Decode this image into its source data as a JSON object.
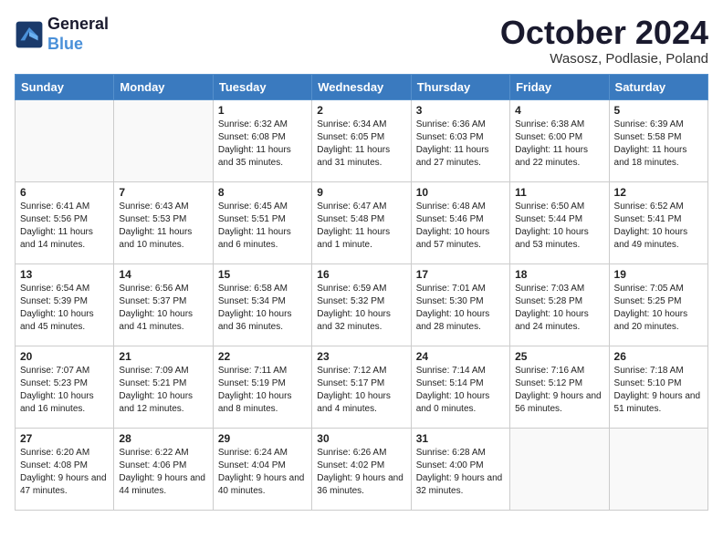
{
  "header": {
    "logo_line1": "General",
    "logo_line2": "Blue",
    "month": "October 2024",
    "location": "Wasosz, Podlasie, Poland"
  },
  "days_of_week": [
    "Sunday",
    "Monday",
    "Tuesday",
    "Wednesday",
    "Thursday",
    "Friday",
    "Saturday"
  ],
  "weeks": [
    [
      {
        "day": "",
        "info": ""
      },
      {
        "day": "",
        "info": ""
      },
      {
        "day": "1",
        "info": "Sunrise: 6:32 AM\nSunset: 6:08 PM\nDaylight: 11 hours and 35 minutes."
      },
      {
        "day": "2",
        "info": "Sunrise: 6:34 AM\nSunset: 6:05 PM\nDaylight: 11 hours and 31 minutes."
      },
      {
        "day": "3",
        "info": "Sunrise: 6:36 AM\nSunset: 6:03 PM\nDaylight: 11 hours and 27 minutes."
      },
      {
        "day": "4",
        "info": "Sunrise: 6:38 AM\nSunset: 6:00 PM\nDaylight: 11 hours and 22 minutes."
      },
      {
        "day": "5",
        "info": "Sunrise: 6:39 AM\nSunset: 5:58 PM\nDaylight: 11 hours and 18 minutes."
      }
    ],
    [
      {
        "day": "6",
        "info": "Sunrise: 6:41 AM\nSunset: 5:56 PM\nDaylight: 11 hours and 14 minutes."
      },
      {
        "day": "7",
        "info": "Sunrise: 6:43 AM\nSunset: 5:53 PM\nDaylight: 11 hours and 10 minutes."
      },
      {
        "day": "8",
        "info": "Sunrise: 6:45 AM\nSunset: 5:51 PM\nDaylight: 11 hours and 6 minutes."
      },
      {
        "day": "9",
        "info": "Sunrise: 6:47 AM\nSunset: 5:48 PM\nDaylight: 11 hours and 1 minute."
      },
      {
        "day": "10",
        "info": "Sunrise: 6:48 AM\nSunset: 5:46 PM\nDaylight: 10 hours and 57 minutes."
      },
      {
        "day": "11",
        "info": "Sunrise: 6:50 AM\nSunset: 5:44 PM\nDaylight: 10 hours and 53 minutes."
      },
      {
        "day": "12",
        "info": "Sunrise: 6:52 AM\nSunset: 5:41 PM\nDaylight: 10 hours and 49 minutes."
      }
    ],
    [
      {
        "day": "13",
        "info": "Sunrise: 6:54 AM\nSunset: 5:39 PM\nDaylight: 10 hours and 45 minutes."
      },
      {
        "day": "14",
        "info": "Sunrise: 6:56 AM\nSunset: 5:37 PM\nDaylight: 10 hours and 41 minutes."
      },
      {
        "day": "15",
        "info": "Sunrise: 6:58 AM\nSunset: 5:34 PM\nDaylight: 10 hours and 36 minutes."
      },
      {
        "day": "16",
        "info": "Sunrise: 6:59 AM\nSunset: 5:32 PM\nDaylight: 10 hours and 32 minutes."
      },
      {
        "day": "17",
        "info": "Sunrise: 7:01 AM\nSunset: 5:30 PM\nDaylight: 10 hours and 28 minutes."
      },
      {
        "day": "18",
        "info": "Sunrise: 7:03 AM\nSunset: 5:28 PM\nDaylight: 10 hours and 24 minutes."
      },
      {
        "day": "19",
        "info": "Sunrise: 7:05 AM\nSunset: 5:25 PM\nDaylight: 10 hours and 20 minutes."
      }
    ],
    [
      {
        "day": "20",
        "info": "Sunrise: 7:07 AM\nSunset: 5:23 PM\nDaylight: 10 hours and 16 minutes."
      },
      {
        "day": "21",
        "info": "Sunrise: 7:09 AM\nSunset: 5:21 PM\nDaylight: 10 hours and 12 minutes."
      },
      {
        "day": "22",
        "info": "Sunrise: 7:11 AM\nSunset: 5:19 PM\nDaylight: 10 hours and 8 minutes."
      },
      {
        "day": "23",
        "info": "Sunrise: 7:12 AM\nSunset: 5:17 PM\nDaylight: 10 hours and 4 minutes."
      },
      {
        "day": "24",
        "info": "Sunrise: 7:14 AM\nSunset: 5:14 PM\nDaylight: 10 hours and 0 minutes."
      },
      {
        "day": "25",
        "info": "Sunrise: 7:16 AM\nSunset: 5:12 PM\nDaylight: 9 hours and 56 minutes."
      },
      {
        "day": "26",
        "info": "Sunrise: 7:18 AM\nSunset: 5:10 PM\nDaylight: 9 hours and 51 minutes."
      }
    ],
    [
      {
        "day": "27",
        "info": "Sunrise: 6:20 AM\nSunset: 4:08 PM\nDaylight: 9 hours and 47 minutes."
      },
      {
        "day": "28",
        "info": "Sunrise: 6:22 AM\nSunset: 4:06 PM\nDaylight: 9 hours and 44 minutes."
      },
      {
        "day": "29",
        "info": "Sunrise: 6:24 AM\nSunset: 4:04 PM\nDaylight: 9 hours and 40 minutes."
      },
      {
        "day": "30",
        "info": "Sunrise: 6:26 AM\nSunset: 4:02 PM\nDaylight: 9 hours and 36 minutes."
      },
      {
        "day": "31",
        "info": "Sunrise: 6:28 AM\nSunset: 4:00 PM\nDaylight: 9 hours and 32 minutes."
      },
      {
        "day": "",
        "info": ""
      },
      {
        "day": "",
        "info": ""
      }
    ]
  ]
}
